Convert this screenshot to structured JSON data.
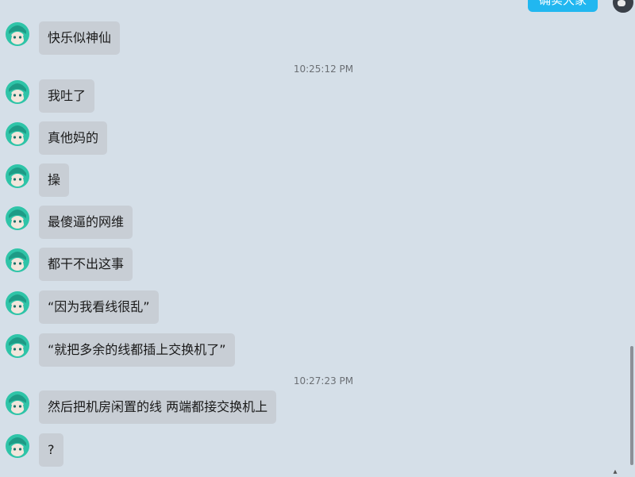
{
  "top": {
    "sent_label": "确实大家"
  },
  "messages": [
    {
      "text": "快乐似神仙"
    },
    {
      "text": "我吐了"
    },
    {
      "text": "真他妈的"
    },
    {
      "text": "操"
    },
    {
      "text": "最傻逼的网维"
    },
    {
      "text": "都干不出这事"
    },
    {
      "text": "“因为我看线很乱”"
    },
    {
      "text": "“就把多余的线都插上交换机了”"
    },
    {
      "text": "然后把机房闲置的线 两端都接交换机上"
    },
    {
      "text": "?"
    }
  ],
  "timestamps": [
    "10:25:12 PM",
    "10:27:23 PM"
  ],
  "colors": {
    "background": "#d5dfe8",
    "bubble": "#c8ced5",
    "sent_bubble": "#21b7f0",
    "avatar_hair": "#2fc4a8"
  },
  "icons": {
    "avatar": "anime-avatar-icon",
    "corner": "arrow-icon"
  }
}
